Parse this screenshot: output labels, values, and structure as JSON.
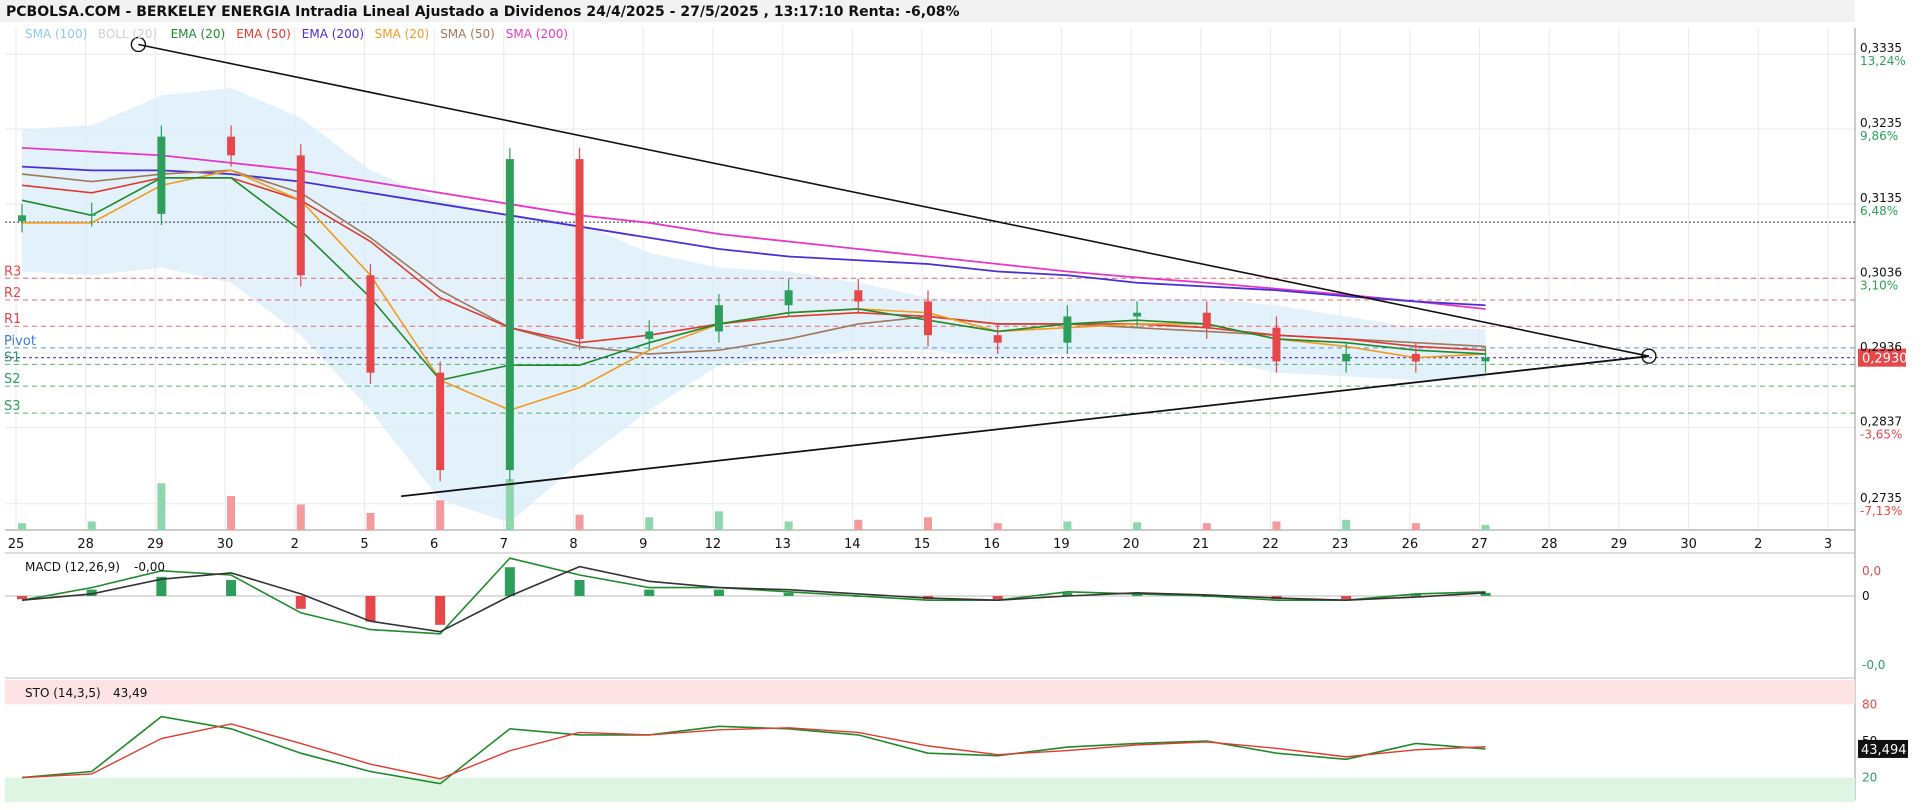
{
  "header": {
    "title": "PCBOLSA.COM - BERKELEY ENERGIA Intradia Lineal Ajustado a Dividenos 24/4/2025 - 27/5/2025 , 13:17:10 Renta: -6,08%"
  },
  "legend": [
    {
      "label": "SMA (100)",
      "color": "#8ec9ee"
    },
    {
      "label": "BOLL (20)",
      "color": "#d0d0d0"
    },
    {
      "label": "EMA (20)",
      "color": "#1f8a2c"
    },
    {
      "label": "EMA (50)",
      "color": "#e03a2f"
    },
    {
      "label": "EMA (200)",
      "color": "#4b2fd6"
    },
    {
      "label": "SMA (20)",
      "color": "#f29b1d"
    },
    {
      "label": "SMA (50)",
      "color": "#a0785a"
    },
    {
      "label": "SMA (200)",
      "color": "#e637c7"
    }
  ],
  "colors": {
    "up": "#2e9e5b",
    "down": "#e5474b",
    "band": "#d9ecfa",
    "grid": "#e9e9e9",
    "last_price_bg": "#e5474b",
    "sto_last_bg": "#111111",
    "resistance": "#e5474b",
    "support": "#2e9e5b",
    "pivot": "#3a7bd5"
  },
  "price_axis": {
    "ticks": [
      {
        "price": "0,3335",
        "pct": "13,24%",
        "sign": "pos"
      },
      {
        "price": "0,3235",
        "pct": "9,86%",
        "sign": "pos"
      },
      {
        "price": "0,3135",
        "pct": "6,48%",
        "sign": "pos"
      },
      {
        "price": "0,3036",
        "pct": "3,10%",
        "sign": "pos"
      },
      {
        "price": "0,2936",
        "pct": "",
        "sign": "none"
      },
      {
        "price": "0,2837",
        "pct": "-3,65%",
        "sign": "neg"
      },
      {
        "price": "0,2735",
        "pct": "-7,13%",
        "sign": "neg"
      }
    ],
    "last_price": "0,2930"
  },
  "pivot_levels": [
    {
      "label": "R3",
      "kind": "r",
      "value": 0.3036
    },
    {
      "label": "R2",
      "kind": "r",
      "value": 0.3007
    },
    {
      "label": "R1",
      "kind": "r",
      "value": 0.2972
    },
    {
      "label": "Pivot",
      "kind": "p",
      "value": 0.2943
    },
    {
      "label": "S1",
      "kind": "s",
      "value": 0.2921
    },
    {
      "label": "S2",
      "kind": "s",
      "value": 0.2892
    },
    {
      "label": "S3",
      "kind": "s",
      "value": 0.2856
    }
  ],
  "x_axis": {
    "labels": [
      "25",
      "28",
      "29",
      "30",
      "2",
      "5",
      "6",
      "7",
      "8",
      "9",
      "12",
      "13",
      "14",
      "15",
      "16",
      "19",
      "20",
      "21",
      "22",
      "23",
      "26",
      "27",
      "28",
      "29",
      "30",
      "2",
      "3"
    ]
  },
  "macd": {
    "label": "MACD (12,26,9)",
    "value": "-0,00",
    "axis": [
      "0,0",
      "0",
      "-0,0"
    ]
  },
  "sto": {
    "label": "STO (14,3,5)",
    "value": "43,49",
    "last": "43,494",
    "axis": [
      "80",
      "50",
      "20"
    ]
  },
  "chart_data": {
    "type": "candlestick",
    "title": "PCBOLSA.COM - BERKELEY ENERGIA Intradia Lineal Ajustado a Dividenos 24/4/2025 - 27/5/2025 , 13:17:10 Renta: -6,08%",
    "x": [
      "25",
      "28",
      "29",
      "30",
      "2",
      "5",
      "6",
      "7",
      "8",
      "9",
      "12",
      "13",
      "14",
      "15",
      "16",
      "19",
      "20",
      "21",
      "22",
      "23",
      "26",
      "27"
    ],
    "close": [
      0.312,
      0.3122,
      0.3225,
      0.32,
      0.304,
      0.291,
      0.278,
      0.3195,
      0.2955,
      0.2965,
      0.3,
      0.302,
      0.3005,
      0.296,
      0.295,
      0.2985,
      0.299,
      0.297,
      0.2925,
      0.2935,
      0.2925,
      0.293
    ],
    "sma20": [
      0.311,
      0.311,
      0.316,
      0.318,
      0.314,
      0.304,
      0.29,
      0.286,
      0.289,
      0.294,
      0.2975,
      0.299,
      0.2995,
      0.299,
      0.2965,
      0.297,
      0.2975,
      0.2975,
      0.2955,
      0.2945,
      0.293,
      0.2935
    ],
    "ema20": [
      0.314,
      0.312,
      0.317,
      0.317,
      0.31,
      0.301,
      0.29,
      0.292,
      0.292,
      0.295,
      0.2975,
      0.299,
      0.2995,
      0.298,
      0.2965,
      0.2975,
      0.298,
      0.2975,
      0.2955,
      0.295,
      0.294,
      0.2935
    ],
    "ema50": [
      0.316,
      0.315,
      0.317,
      0.317,
      0.314,
      0.3085,
      0.301,
      0.297,
      0.295,
      0.296,
      0.2975,
      0.2985,
      0.299,
      0.2985,
      0.2975,
      0.2975,
      0.2975,
      0.297,
      0.296,
      0.2955,
      0.2945,
      0.294
    ],
    "sma50": [
      0.3175,
      0.3165,
      0.3175,
      0.318,
      0.315,
      0.309,
      0.302,
      0.297,
      0.2945,
      0.2935,
      0.294,
      0.2955,
      0.2975,
      0.2985,
      0.2975,
      0.2975,
      0.297,
      0.2965,
      0.296,
      0.2955,
      0.295,
      0.2945
    ],
    "ema200": [
      0.3185,
      0.318,
      0.318,
      0.3175,
      0.3165,
      0.315,
      0.3135,
      0.312,
      0.3105,
      0.309,
      0.3075,
      0.3065,
      0.306,
      0.3055,
      0.3045,
      0.304,
      0.303,
      0.3025,
      0.302,
      0.3012,
      0.3005,
      0.3
    ],
    "sma200": [
      0.321,
      0.3205,
      0.32,
      0.319,
      0.318,
      0.3165,
      0.315,
      0.3135,
      0.312,
      0.311,
      0.3095,
      0.3085,
      0.3075,
      0.3065,
      0.3055,
      0.3045,
      0.3037,
      0.303,
      0.3022,
      0.3014,
      0.3005,
      0.2995
    ],
    "boll_upper": [
      0.3235,
      0.324,
      0.328,
      0.329,
      0.325,
      0.318,
      0.314,
      0.312,
      0.311,
      0.307,
      0.305,
      0.3045,
      0.303,
      0.301,
      0.3005,
      0.3005,
      0.3008,
      0.3008,
      0.3,
      0.2985,
      0.297,
      0.2968
    ],
    "boll_lower": [
      0.3045,
      0.304,
      0.305,
      0.303,
      0.296,
      0.286,
      0.274,
      0.271,
      0.279,
      0.286,
      0.292,
      0.293,
      0.294,
      0.294,
      0.293,
      0.2935,
      0.2935,
      0.293,
      0.291,
      0.2905,
      0.29,
      0.2902
    ],
    "volume": [
      8,
      10,
      55,
      40,
      30,
      20,
      35,
      60,
      18,
      15,
      22,
      10,
      12,
      15,
      8,
      10,
      9,
      8,
      10,
      12,
      8,
      6
    ],
    "macd_hist": [
      -0.1,
      0.2,
      0.6,
      0.5,
      -0.4,
      -0.8,
      -0.9,
      0.9,
      0.5,
      0.2,
      0.2,
      0.1,
      0.0,
      -0.1,
      -0.1,
      0.1,
      0.05,
      0.0,
      -0.1,
      -0.1,
      0.05,
      0.1
    ],
    "stochastic": [
      20,
      25,
      70,
      60,
      40,
      25,
      15,
      60,
      55,
      55,
      62,
      60,
      55,
      40,
      38,
      45,
      48,
      50,
      40,
      35,
      48,
      43.49
    ],
    "ylim": [
      0.27,
      0.337
    ],
    "trendlines": "converging triangle from 29 Apr high and 6 May low toward 29 May"
  }
}
